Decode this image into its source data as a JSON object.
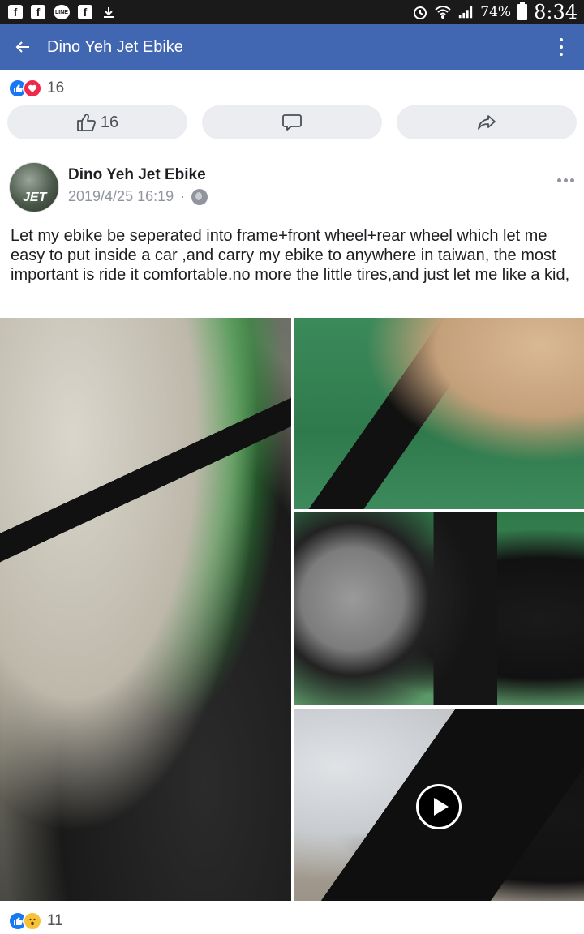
{
  "status_bar": {
    "battery_percent": "74%",
    "time": "8:34",
    "icons": [
      "facebook-icon",
      "facebook-icon",
      "line-icon",
      "facebook-icon",
      "download-icon",
      "alarm-icon",
      "wifi-icon",
      "signal-icon",
      "battery-icon"
    ]
  },
  "app_bar": {
    "title": "Dino Yeh Jet Ebike",
    "back_icon": "back-arrow-icon",
    "menu_icon": "more-vertical-icon",
    "background": "#4267b2"
  },
  "reactions_top": {
    "count": "16",
    "types": [
      "like",
      "love"
    ]
  },
  "actions": {
    "like_count": "16",
    "like_icon": "thumbs-up-icon",
    "comment_icon": "comment-icon",
    "share_icon": "share-icon"
  },
  "post": {
    "author": "Dino Yeh Jet Ebike",
    "avatar_text": "JET",
    "timestamp": "2019/4/25 16:19",
    "separator": "·",
    "privacy_icon": "globe-icon",
    "text": "Let my ebike be seperated into frame+front wheel+rear wheel which let me easy to put inside a car ,and carry my ebike to anywhere in taiwan, the most important is ride it comfortable.no more the little tires,and just let me  like a kid,"
  },
  "media": {
    "photos": [
      "handlebar-photo",
      "handlebar-top-photo",
      "disc-brake-photo",
      "frame-video"
    ],
    "video_index": 3
  },
  "reactions_bottom": {
    "count": "11",
    "types": [
      "like",
      "wow"
    ]
  },
  "colors": {
    "accent": "#4267b2",
    "like": "#1877f2",
    "love": "#f0284a",
    "wow": "#f7c23a",
    "pill": "#ebedf0",
    "meta_text": "#90949c"
  }
}
